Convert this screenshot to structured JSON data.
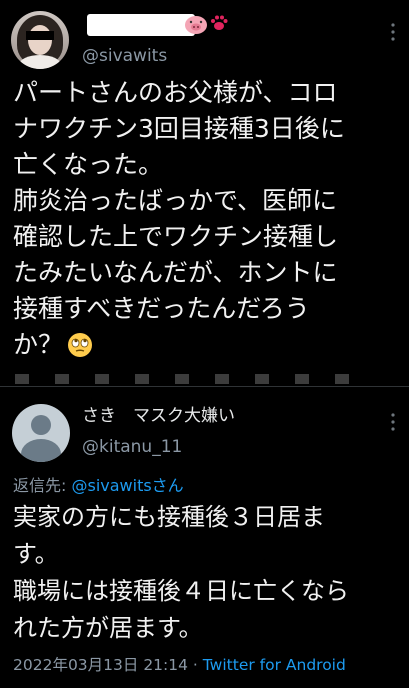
{
  "tweet1": {
    "handle": "@sivawits",
    "text_lines": [
      "パートさんのお父様が、コロ",
      "ナワクチン3回目接種3日後に",
      "亡くなった。",
      "肺炎治ったばっかで、医師に",
      "確認した上でワクチン接種し",
      "たみたいなんだが、ホントに",
      "接種すべきだったんだろう",
      "か？"
    ],
    "emoji": "eye-roll-emoji"
  },
  "tweet2": {
    "display_name": "さき　マスク大嫌い",
    "handle": "@kitanu_11",
    "reply_prefix": "返信先: ",
    "reply_to": "@sivawitsさん",
    "text_lines": [
      "実家の方にも接種後３日居ま",
      "す。",
      "職場には接種後４日に亡くなら",
      "れた方が居ます。"
    ],
    "timestamp": "2022年03月13日 21:14",
    "separator": " · ",
    "client": "Twitter for Android"
  },
  "colors": {
    "background": "#000000",
    "text": "#e7e9ea",
    "secondary": "#8b98a5",
    "link": "#1d9bf0"
  }
}
